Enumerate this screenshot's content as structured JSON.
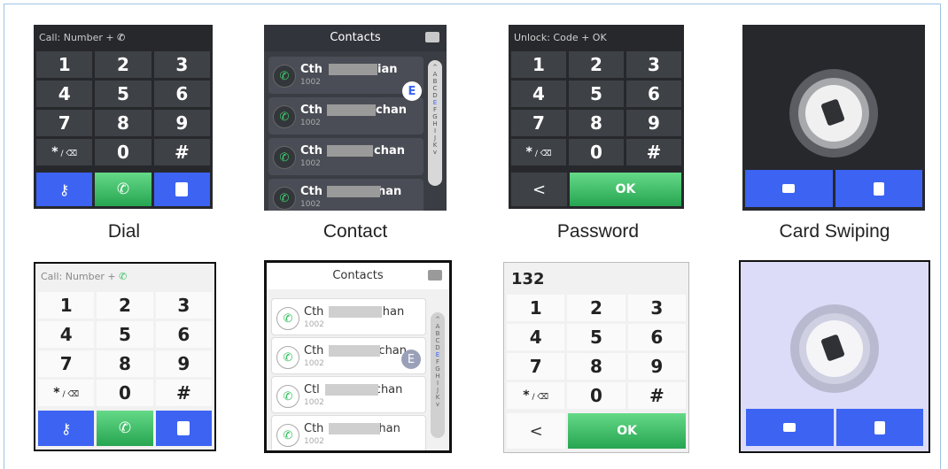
{
  "captions": {
    "dial": "Dial",
    "contact": "Contact",
    "password": "Password",
    "card": "Card Swiping"
  },
  "dial": {
    "header": "Call: Number +",
    "keys": [
      "1",
      "2",
      "3",
      "4",
      "5",
      "6",
      "7",
      "8",
      "9",
      "*",
      "0",
      "#"
    ],
    "star_suffix": "/ ⌫"
  },
  "contacts": {
    "title": "Contacts",
    "rows": [
      {
        "name_a": "Cth",
        "name_b": "ian",
        "number": "1002"
      },
      {
        "name_a": "Cth",
        "name_b": "chan",
        "number": "1002"
      },
      {
        "name_a": "Cth",
        "name_b": "chan",
        "number": "1002"
      },
      {
        "name_a": "Cth",
        "name_b": "han",
        "number": "1002"
      }
    ],
    "rows_light": [
      {
        "name_a": "Cth",
        "name_b": ":han",
        "number": "1002"
      },
      {
        "name_a": "Cth",
        "name_b": "chan",
        "number": "1002"
      },
      {
        "name_a": "Ctl",
        "name_b": "chan",
        "number": "1002"
      },
      {
        "name_a": "Cth",
        "name_b": "han",
        "number": "1002"
      }
    ],
    "alphabet": [
      "^",
      "A",
      "B",
      "C",
      "D",
      "E",
      "F",
      "G",
      "H",
      "I",
      "J",
      "K",
      "v"
    ],
    "badge": "E"
  },
  "password": {
    "header": "Unlock: Code + OK",
    "typed_value": "132",
    "ok_label": "OK",
    "back_label": "<"
  },
  "colors": {
    "accent_blue": "#3c63f2",
    "accent_green": "#2fbf5a",
    "dark_bg": "#26282c",
    "card_light_bg": "#dcdcf8"
  }
}
